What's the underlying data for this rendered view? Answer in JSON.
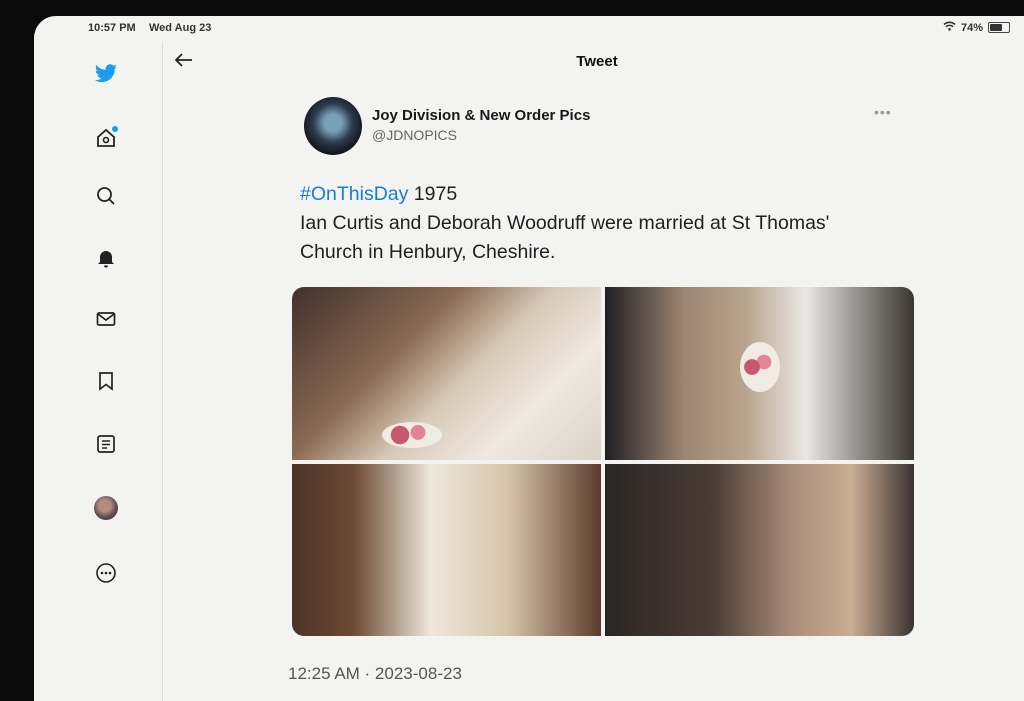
{
  "status_bar": {
    "time": "10:57 PM",
    "date": "Wed Aug 23",
    "battery": "74%",
    "battery_level": 0.74
  },
  "sidebar": {
    "items": [
      {
        "name": "twitter-logo-icon"
      },
      {
        "name": "home-icon"
      },
      {
        "name": "search-icon"
      },
      {
        "name": "notifications-icon"
      },
      {
        "name": "messages-icon"
      },
      {
        "name": "bookmarks-icon"
      },
      {
        "name": "lists-icon"
      },
      {
        "name": "profile-avatar"
      },
      {
        "name": "more-icon"
      }
    ]
  },
  "header": {
    "title": "Tweet"
  },
  "tweet": {
    "author_name": "Joy Division & New Order Pics",
    "author_handle": "@JDNOPICS",
    "hashtag": "#OnThisDay",
    "year": " 1975",
    "body": "Ian Curtis and Deborah Woodruff were married at St Thomas' Church in Henbury, Cheshire.",
    "timestamp": "12:25 AM · 2023-08-23"
  },
  "colors": {
    "accent": "#1d9bf0",
    "hashtag": "#1d7bd8"
  }
}
